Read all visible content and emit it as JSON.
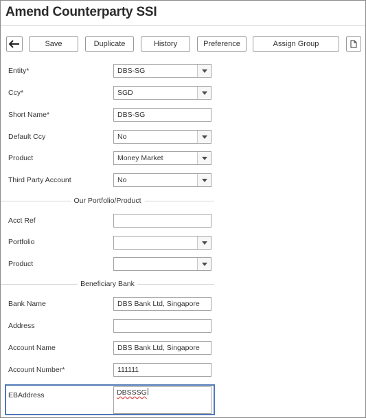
{
  "page": {
    "title": "Amend Counterparty SSI"
  },
  "toolbar": {
    "back_icon": "arrow-left-icon",
    "save": "Save",
    "duplicate": "Duplicate",
    "history": "History",
    "preference": "Preference",
    "assign_group": "Assign Group",
    "doc_icon": "document-icon"
  },
  "form": {
    "entity": {
      "label": "Entity*",
      "value": "DBS-SG"
    },
    "ccy": {
      "label": "Ccy*",
      "value": "SGD"
    },
    "short_name": {
      "label": "Short Name*",
      "value": "DBS-SG"
    },
    "default_ccy": {
      "label": "Default Ccy",
      "value": "No"
    },
    "product": {
      "label": "Product",
      "value": "Money Market"
    },
    "third_party": {
      "label": "Third Party Account",
      "value": "No"
    }
  },
  "our_portfolio": {
    "title": "Our Portfolio/Product",
    "acct_ref": {
      "label": "Acct Ref",
      "value": ""
    },
    "portfolio": {
      "label": "Portfolio",
      "value": ""
    },
    "product": {
      "label": "Product",
      "value": ""
    }
  },
  "beneficiary": {
    "title": "Beneficiary Bank",
    "bank_name": {
      "label": "Bank Name",
      "value": "DBS Bank Ltd, Singapore"
    },
    "address": {
      "label": "Address",
      "value": ""
    },
    "account_name": {
      "label": "Account Name",
      "value": "DBS Bank Ltd, Singapore"
    },
    "account_number": {
      "label": "Account Number*",
      "value": "111111"
    },
    "eb_address": {
      "label": "EBAddress",
      "value": "DBSSSG"
    }
  },
  "colors": {
    "focus_border": "#4e78b5",
    "spellcheck": "#e04040"
  }
}
